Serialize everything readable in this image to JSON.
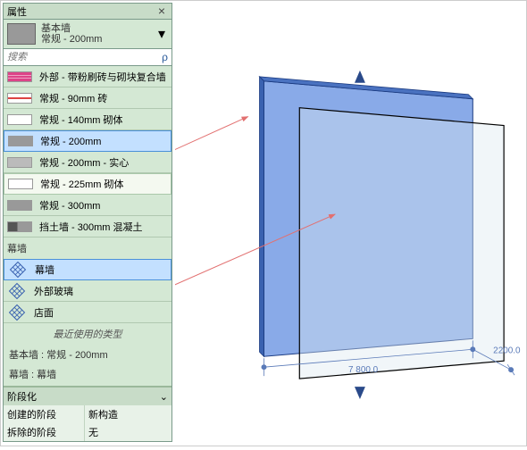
{
  "panel": {
    "title": "属性",
    "close_glyph": "×",
    "selected_family": "基本墙",
    "selected_type": "常规 - 200mm",
    "dropdown_glyph": "▾",
    "search_placeholder": "搜索",
    "search_icon": "ρ"
  },
  "list": {
    "items": [
      {
        "label": "外部 - 带粉刷砖与砌块复合墙",
        "swatch": "sw-brick"
      },
      {
        "label": "常规 - 90mm 砖",
        "swatch": "sw-red"
      },
      {
        "label": "常规 - 140mm 砌体",
        "swatch": "sw-white"
      },
      {
        "label": "常规 - 200mm",
        "swatch": "sw-grey",
        "highlighted": true
      },
      {
        "label": "常规 - 200mm - 实心",
        "swatch": "sw-solid"
      },
      {
        "label": "常规 - 225mm 砌体",
        "swatch": "sw-white",
        "hovered": true
      },
      {
        "label": "常规 - 300mm",
        "swatch": "sw-grey"
      },
      {
        "label": "挡土墙 - 300mm 混凝土",
        "swatch": "sw-ret"
      }
    ],
    "category2": "幕墙",
    "curtain": [
      {
        "label": "幕墙",
        "highlighted": true
      },
      {
        "label": "外部玻璃"
      },
      {
        "label": "店面"
      }
    ],
    "recent_header": "最近使用的类型",
    "recent": [
      "基本墙 : 常规 - 200mm",
      "幕墙 : 幕墙"
    ]
  },
  "phase": {
    "header": "阶段化",
    "expand_glyph": "⌄",
    "rows": [
      {
        "k": "创建的阶段",
        "v": "新构造"
      },
      {
        "k": "拆除的阶段",
        "v": "无"
      }
    ]
  },
  "viewport": {
    "dim1": "7 800.0",
    "dim2": "2200.0"
  }
}
